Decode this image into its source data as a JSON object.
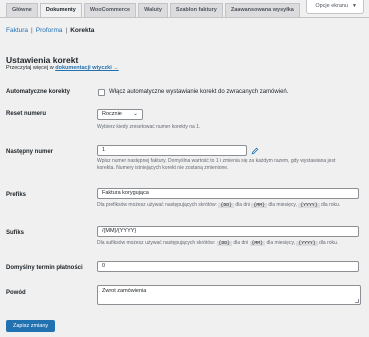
{
  "screen_options": {
    "label": "Opcje ekranu"
  },
  "tabs": [
    {
      "label": "Główne"
    },
    {
      "label": "Dokumenty"
    },
    {
      "label": "WooCommerce"
    },
    {
      "label": "Waluty"
    },
    {
      "label": "Szablon faktury"
    },
    {
      "label": "Zaawansowana wysyłka"
    }
  ],
  "subnav": {
    "items": [
      "Faktura",
      "Proforma",
      "Korekta"
    ],
    "separator": "|"
  },
  "section": {
    "title": "Ustawienia korekt",
    "desc_prefix": "Przeczytaj więcej w",
    "desc_link": "dokumentacji wtyczki →"
  },
  "fields": {
    "auto": {
      "label": "Automatyczne korekty",
      "checkbox_label": "Włącz automatyczne wystawianie korekt do zwracanych zamówień.",
      "checked": false
    },
    "reset": {
      "label": "Reset numeru",
      "value": "Rocznie",
      "desc": "Wybierz kiedy zresetować numer korekty na 1."
    },
    "next_number": {
      "label": "Następny numer",
      "value": "1",
      "desc_line1": "Wpisz numer następnej faktury. Domyślna wartość to 1 i zmienia się za każdym razem, gdy wystawiana jest",
      "desc_line2": "korekta. Numery istniejących korekt nie zostaną zmienione."
    },
    "prefix": {
      "label": "Prefiks",
      "value": "Faktura korygująca",
      "desc_a": "Dla prefiksów możesz używać następujących skrótów:",
      "code_dd": "{DD}",
      "desc_b": "dla dni",
      "code_mm": "{MM}",
      "desc_c": "dla miesięcy,",
      "code_yyyy": "{YYYY}",
      "desc_d": "dla roku."
    },
    "suffix": {
      "label": "Sufiks",
      "value": "/{MM}/{YYYY}",
      "desc_a": "Dla sufiksów możesz używać następujących skrótów:",
      "code_dd": "{DD}",
      "desc_b": "dla dni",
      "code_mm": "{MM}",
      "desc_c": "dla miesięcy,",
      "code_yyyy": "{YYYY}",
      "desc_d": "dla roku."
    },
    "due_days": {
      "label": "Domyślny termin płatności",
      "value": "0"
    },
    "reason": {
      "label": "Powód",
      "value": "Zwrot zamówienia"
    }
  },
  "save_button": {
    "label": "Zapisz zmiany"
  },
  "colors": {
    "accent": "#2271b1",
    "background": "#f0f0f1"
  }
}
